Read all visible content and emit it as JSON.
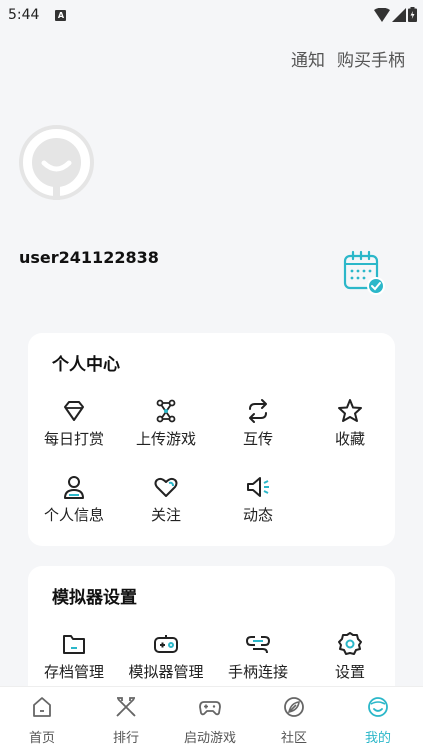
{
  "status_bar": {
    "time": "5:44",
    "badge": "A"
  },
  "header": {
    "notify_label": "通知",
    "buy_label": "购买手柄"
  },
  "profile": {
    "username": "user241122838"
  },
  "personal_center": {
    "title": "个人中心",
    "items": [
      {
        "label": "每日打赏",
        "icon": "diamond-icon"
      },
      {
        "label": "上传游戏",
        "icon": "upload-game-icon"
      },
      {
        "label": "互传",
        "icon": "transfer-icon"
      },
      {
        "label": "收藏",
        "icon": "star-icon"
      },
      {
        "label": "个人信息",
        "icon": "user-icon"
      },
      {
        "label": "关注",
        "icon": "heart-icon"
      },
      {
        "label": "动态",
        "icon": "speaker-icon"
      }
    ]
  },
  "emulator_settings": {
    "title": "模拟器设置",
    "items": [
      {
        "label": "存档管理",
        "icon": "folder-icon"
      },
      {
        "label": "模拟器管理",
        "icon": "gamepad-icon"
      },
      {
        "label": "手柄连接",
        "icon": "link-icon"
      },
      {
        "label": "设置",
        "icon": "gear-icon"
      }
    ]
  },
  "tabbar": {
    "active": "我的",
    "accent_color": "#2bb7c9",
    "tabs": [
      {
        "label": "首页",
        "icon": "home-icon"
      },
      {
        "label": "排行",
        "icon": "ranking-icon"
      },
      {
        "label": "启动游戏",
        "icon": "controller-icon"
      },
      {
        "label": "社区",
        "icon": "leaf-icon"
      },
      {
        "label": "我的",
        "icon": "face-icon"
      }
    ]
  }
}
